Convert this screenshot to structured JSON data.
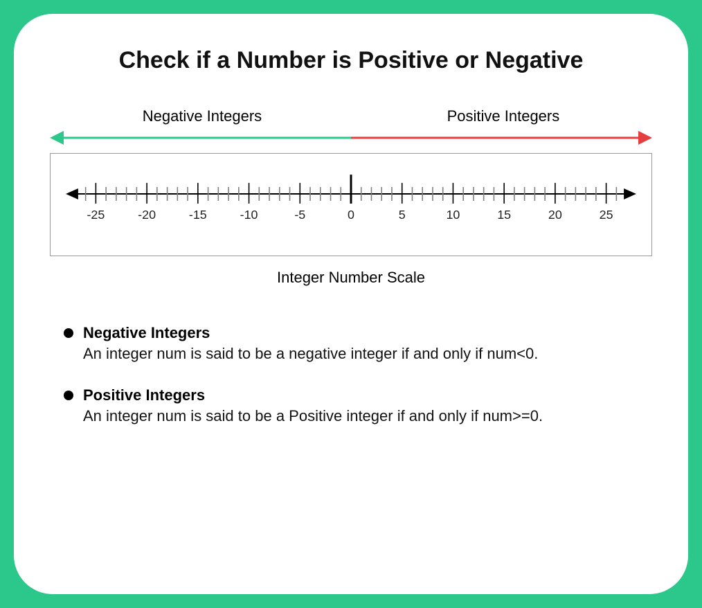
{
  "title": "Check if a Number is Positive or Negative",
  "labels": {
    "negative": "Negative Integers",
    "positive": "Positive Integers"
  },
  "caption": "Integer Number Scale",
  "colors": {
    "negative": "#2bc78b",
    "positive": "#e53e3e"
  },
  "numberline": {
    "min": -27,
    "max": 27,
    "majorTicks": [
      -25,
      -20,
      -15,
      -10,
      -5,
      0,
      5,
      10,
      15,
      20,
      25
    ]
  },
  "definitions": [
    {
      "term": "Negative Integers",
      "text": "An integer num is said to be a negative integer if and only if num<0."
    },
    {
      "term": "Positive Integers",
      "text": "An integer num is said to be a Positive integer if and only if num>=0."
    }
  ]
}
